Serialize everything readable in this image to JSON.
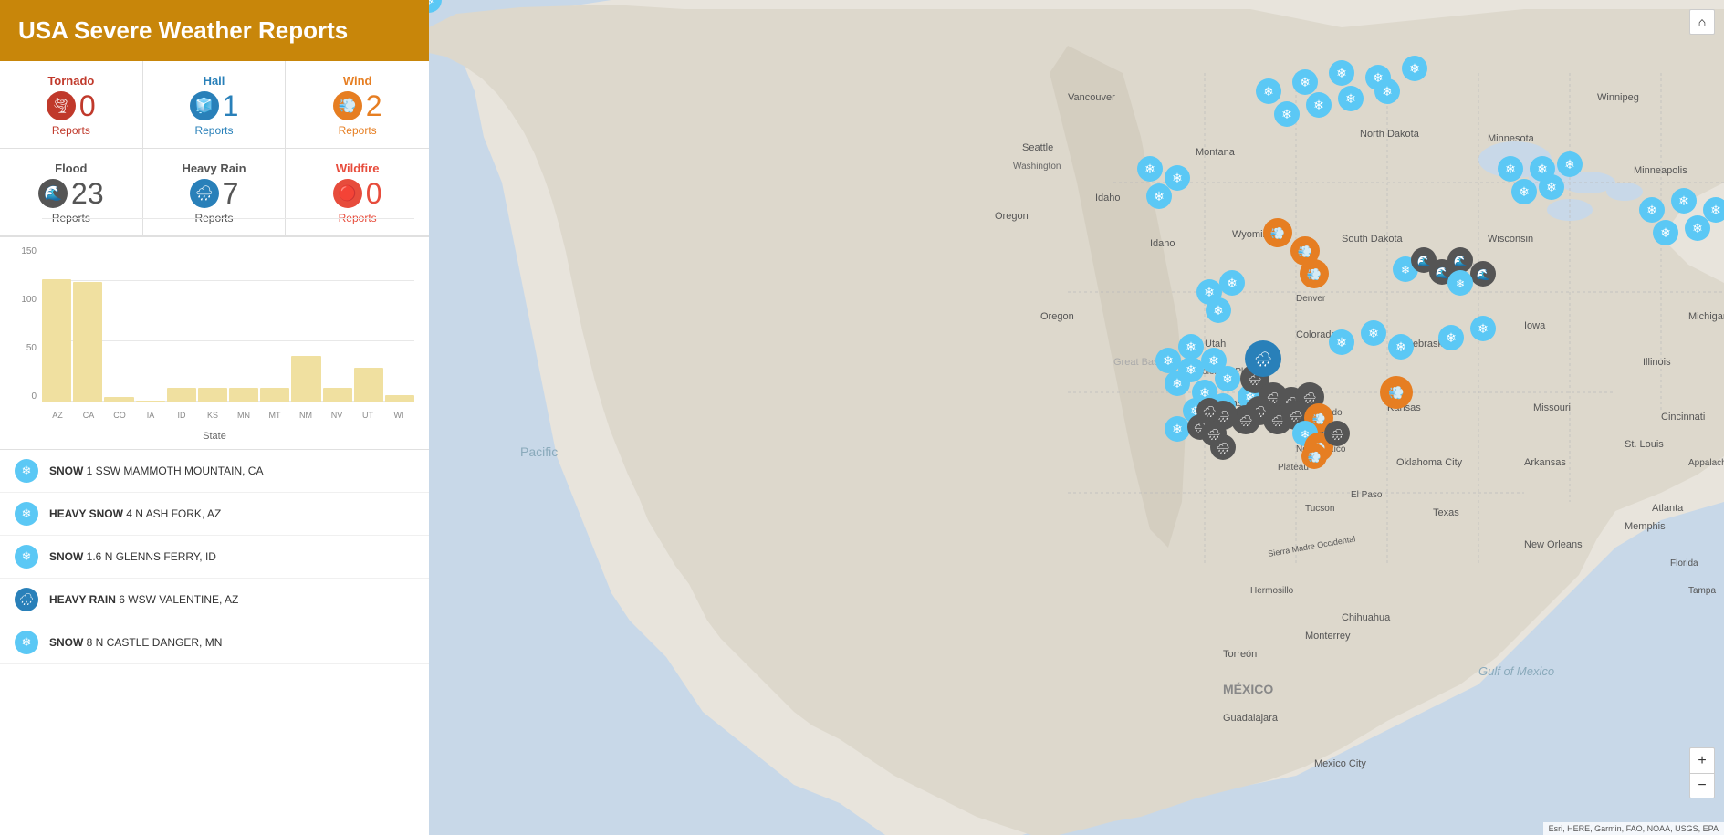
{
  "header": {
    "title": "USA Severe Weather Reports",
    "bg_color": "#c8860a"
  },
  "stats": [
    {
      "id": "tornado",
      "label": "Tornado",
      "count": "0",
      "reports": "Reports",
      "icon": "🌪",
      "label_class": "tornado-label",
      "icon_class": "tornado-icon-bg",
      "num_class": "tornado-num",
      "rep_class": "tornado-reports"
    },
    {
      "id": "hail",
      "label": "Hail",
      "count": "1",
      "reports": "Reports",
      "icon": "🧊",
      "label_class": "hail-label",
      "icon_class": "hail-icon-bg",
      "num_class": "hail-num",
      "rep_class": "hail-reports"
    },
    {
      "id": "wind",
      "label": "Wind",
      "count": "2",
      "reports": "Reports",
      "icon": "💨",
      "label_class": "wind-label",
      "icon_class": "wind-icon-bg",
      "num_class": "wind-num",
      "rep_class": "wind-reports"
    },
    {
      "id": "flood",
      "label": "Flood",
      "count": "23",
      "reports": "Reports",
      "icon": "🌊",
      "label_class": "flood-label",
      "icon_class": "flood-icon-bg",
      "num_class": "flood-num",
      "rep_class": "flood-reports"
    },
    {
      "id": "heavyrain",
      "label": "Heavy Rain",
      "count": "7",
      "reports": "Reports",
      "icon": "🌧",
      "label_class": "heavyrain-label",
      "icon_class": "heavyrain-icon-bg",
      "num_class": "heavyrain-num",
      "rep_class": "heavyrain-reports"
    },
    {
      "id": "wildfire",
      "label": "Wildfire",
      "count": "0",
      "reports": "Reports",
      "icon": "🔴",
      "label_class": "wildfire-label",
      "icon_class": "wildfire-icon-bg",
      "num_class": "wildfire-num",
      "rep_class": "wildfire-reports"
    }
  ],
  "chart": {
    "y_labels": [
      "150",
      "100",
      "50",
      "0"
    ],
    "state_title": "State",
    "bars": [
      {
        "state": "AZ",
        "height_pct": 72
      },
      {
        "state": "CA",
        "height_pct": 70
      },
      {
        "state": "CO",
        "height_pct": 3
      },
      {
        "state": "IA",
        "height_pct": 0
      },
      {
        "state": "ID",
        "height_pct": 8
      },
      {
        "state": "KS",
        "height_pct": 8
      },
      {
        "state": "MN",
        "height_pct": 8
      },
      {
        "state": "MT",
        "height_pct": 8
      },
      {
        "state": "NM",
        "height_pct": 27
      },
      {
        "state": "NV",
        "height_pct": 8
      },
      {
        "state": "UT",
        "height_pct": 20
      },
      {
        "state": "WI",
        "height_pct": 4
      }
    ],
    "max_value": 150
  },
  "reports": [
    {
      "id": 1,
      "type": "SNOW",
      "detail": "1 SSW MAMMOTH MOUNTAIN, CA",
      "icon_class": "snow-icon-bg",
      "icon": "❄"
    },
    {
      "id": 2,
      "type": "HEAVY SNOW",
      "detail": "4 N ASH FORK, AZ",
      "icon_class": "snow-icon-bg",
      "icon": "❄"
    },
    {
      "id": 3,
      "type": "SNOW",
      "detail": "1.6 N GLENNS FERRY, ID",
      "icon_class": "snow-icon-bg",
      "icon": "❄"
    },
    {
      "id": 4,
      "type": "HEAVY RAIN",
      "detail": "6 WSW VALENTINE, AZ",
      "icon_class": "heavyrain-icon-small",
      "icon": "🌧"
    },
    {
      "id": 5,
      "type": "SNOW",
      "detail": "8 N CASTLE DANGER, MN",
      "icon_class": "snow-icon-bg",
      "icon": "❄"
    }
  ],
  "map": {
    "attribution": "Esri, HERE, Garmin, FAO, NOAA, USGS, EPA",
    "zoom_plus": "+",
    "zoom_minus": "−",
    "home_icon": "⌂"
  }
}
